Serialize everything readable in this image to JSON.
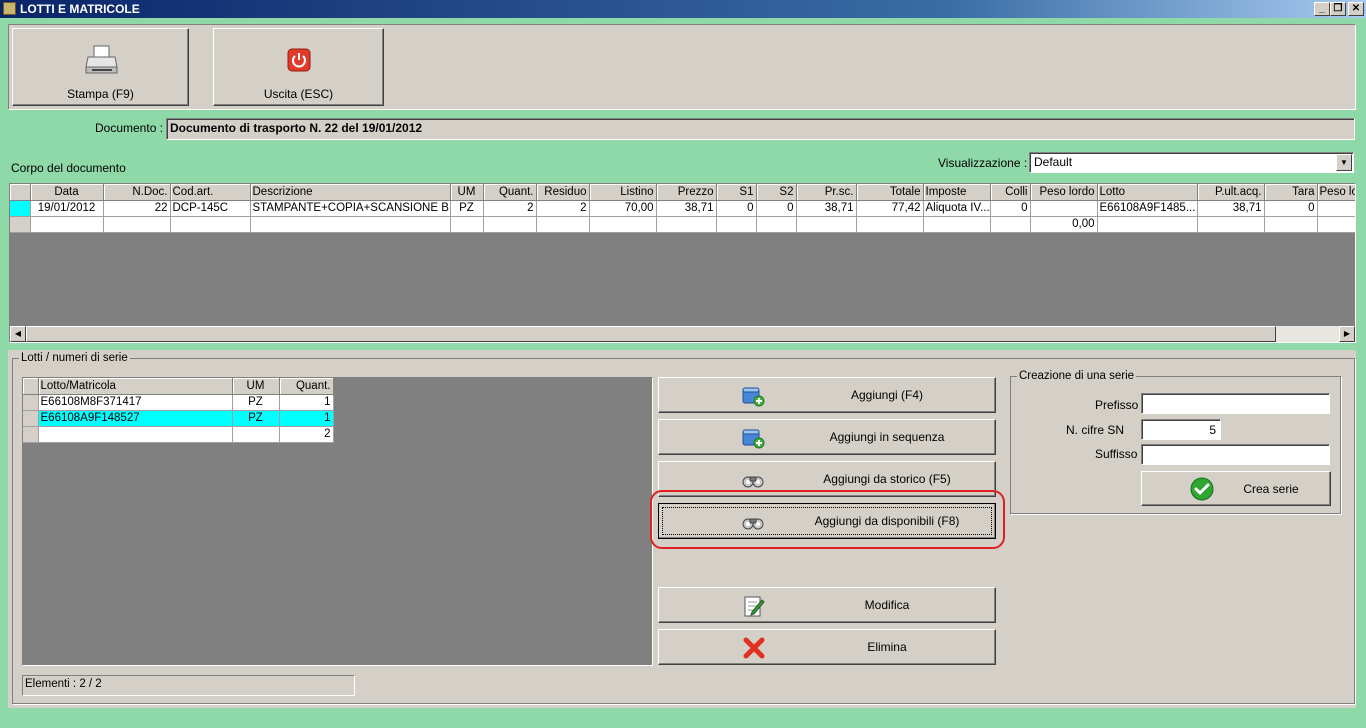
{
  "window": {
    "title": "LOTTI E MATRICOLE",
    "min": "_",
    "restore": "❐",
    "close": "✕"
  },
  "toolbar": {
    "print_label": "Stampa (F9)",
    "exit_label": "Uscita (ESC)"
  },
  "document": {
    "label": "Documento :",
    "value": "Documento di trasporto N. 22 del 19/01/2012"
  },
  "body_section": {
    "label": "Corpo del documento",
    "view_label": "Visualizzazione :",
    "view_value": "Default"
  },
  "main_grid": {
    "columns": [
      "Data",
      "N.Doc.",
      "Cod.art.",
      "Descrizione",
      "UM",
      "Quant.",
      "Residuo",
      "Listino",
      "Prezzo",
      "S1",
      "S2",
      "Pr.sc.",
      "Totale",
      "Imposte",
      "Colli",
      "Peso lordo",
      "Lotto",
      "P.ult.acq.",
      "Tara",
      "Peso lo"
    ],
    "rows": [
      [
        "19/01/2012",
        "22",
        "DCP-145C",
        "STAMPANTE+COPIA+SCANSIONE B...",
        "PZ",
        "2",
        "2",
        "70,00",
        "38,71",
        "0",
        "0",
        "38,71",
        "77,42",
        "Aliquota IV...",
        "0",
        "",
        "E66108A9F1485...",
        "38,71",
        "0",
        ""
      ],
      [
        "",
        "",
        "",
        "",
        "",
        "",
        "",
        "",
        "",
        "",
        "",
        "",
        "",
        "",
        "",
        "0,00",
        "",
        "",
        "",
        ""
      ]
    ]
  },
  "lots_section": {
    "label": "Lotti / numeri di serie",
    "columns": [
      "Lotto/Matricola",
      "UM",
      "Quant."
    ],
    "rows": [
      [
        "E66108M8F371417",
        "PZ",
        "1"
      ],
      [
        "E66108A9F148527",
        "PZ",
        "1"
      ],
      [
        "",
        "",
        "2"
      ]
    ],
    "status": "Elementi : 2 / 2"
  },
  "actions": {
    "add": "Aggiungi (F4)",
    "add_sequence": "Aggiungi in sequenza",
    "add_history": "Aggiungi da storico (F5)",
    "add_available": "Aggiungi da disponibili (F8)",
    "edit": "Modifica",
    "delete": "Elimina"
  },
  "series": {
    "title": "Creazione di una serie",
    "prefix_label": "Prefisso",
    "prefix_value": "",
    "digits_label": "N. cifre SN",
    "digits_value": "5",
    "suffix_label": "Suffisso",
    "suffix_value": "",
    "create_label": "Crea serie"
  },
  "colors": {
    "highlight": "#00ffff",
    "accent_ring": "#e02020",
    "background": "#8fd9a8"
  }
}
